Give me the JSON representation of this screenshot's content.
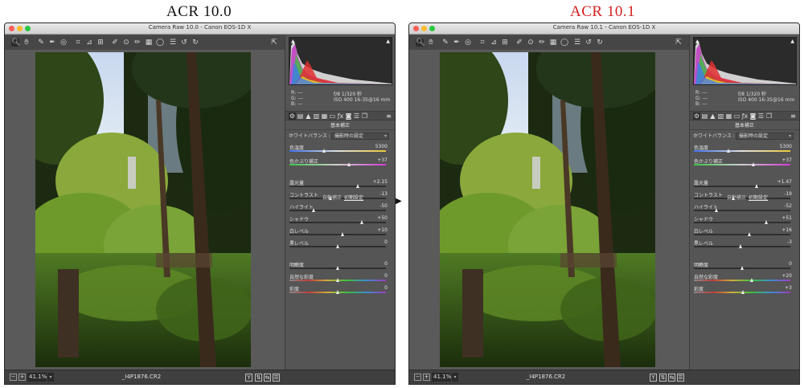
{
  "headings": {
    "left": {
      "text": "ACR 10.0",
      "color": "#111111"
    },
    "right": {
      "text": "ACR 10.1",
      "color": "#d42020"
    }
  },
  "arrow": "▶",
  "windows": [
    {
      "title": "Camera Raw 10.0 - Canon EOS-1D X",
      "rgb": [
        "R:  ---",
        "G:  ---",
        "B:  ---"
      ],
      "exif1": "f/8    1/320 秒",
      "exif2": "ISO 400   16-35@16 mm",
      "panel_title": "基本補正",
      "wb_label": "ホワイトバランス :",
      "wb_value": "撮影時の設定",
      "auto": "自動補正",
      "default": "初期設定",
      "zoom": "41.1%",
      "filename": "_I4P1876.CR2",
      "sliders": {
        "temp": {
          "label": "色温度",
          "value": "5300",
          "pos": 0.36
        },
        "tint": {
          "label": "色かぶり補正",
          "value": "+37",
          "pos": 0.62
        },
        "exposure": {
          "label": "露光量",
          "value": "+2.15",
          "pos": 0.71
        },
        "contrast": {
          "label": "コントラスト",
          "value": "-13",
          "pos": 0.43
        },
        "highlights": {
          "label": "ハイライト",
          "value": "-50",
          "pos": 0.25
        },
        "shadows": {
          "label": "シャドウ",
          "value": "+50",
          "pos": 0.75
        },
        "whites": {
          "label": "白レベル",
          "value": "+10",
          "pos": 0.55
        },
        "blacks": {
          "label": "黒レベル",
          "value": "0",
          "pos": 0.5
        },
        "clarity": {
          "label": "明瞭度",
          "value": "0",
          "pos": 0.5
        },
        "vibrance": {
          "label": "自然な彩度",
          "value": "0",
          "pos": 0.5
        },
        "saturation": {
          "label": "彩度",
          "value": "0",
          "pos": 0.5
        }
      }
    },
    {
      "title": "Camera Raw 10.1 - Canon EOS-1D X",
      "rgb": [
        "R:  ---",
        "G:  ---",
        "B:  ---"
      ],
      "exif1": "f/8    1/320 秒",
      "exif2": "ISO 400   16-35@16 mm",
      "panel_title": "基本補正",
      "wb_label": "ホワイトバランス :",
      "wb_value": "撮影時の設定",
      "auto": "自動補正",
      "default": "初期設定",
      "zoom": "41.1%",
      "filename": "_I4P1876.CR2",
      "sliders": {
        "temp": {
          "label": "色温度",
          "value": "5300",
          "pos": 0.36
        },
        "tint": {
          "label": "色かぶり補正",
          "value": "+37",
          "pos": 0.62
        },
        "exposure": {
          "label": "露光量",
          "value": "+1.47",
          "pos": 0.65
        },
        "contrast": {
          "label": "コントラスト",
          "value": "-19",
          "pos": 0.41
        },
        "highlights": {
          "label": "ハイライト",
          "value": "-52",
          "pos": 0.24
        },
        "shadows": {
          "label": "シャドウ",
          "value": "+51",
          "pos": 0.75
        },
        "whites": {
          "label": "白レベル",
          "value": "+16",
          "pos": 0.58
        },
        "blacks": {
          "label": "黒レベル",
          "value": "-3",
          "pos": 0.49
        },
        "clarity": {
          "label": "明瞭度",
          "value": "0",
          "pos": 0.5
        },
        "vibrance": {
          "label": "自然な彩度",
          "value": "+20",
          "pos": 0.6
        },
        "saturation": {
          "label": "彩度",
          "value": "+3",
          "pos": 0.51
        }
      }
    }
  ]
}
